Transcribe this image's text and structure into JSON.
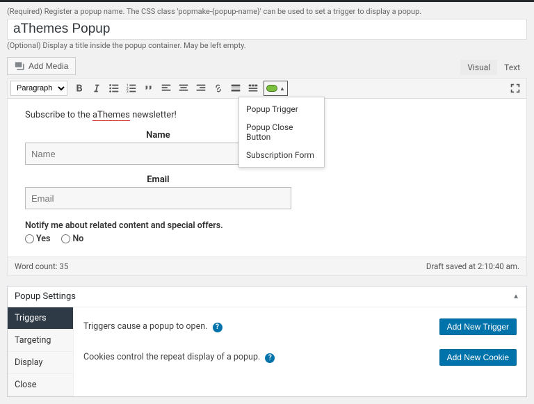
{
  "helper": {
    "name": "(Required) Register a popup name. The CSS class 'popmake-{popup-name}' can be used to set a trigger to display a popup.",
    "title": "(Optional) Display a title inside the popup container. May be left empty."
  },
  "title_value": "aThemes Popup",
  "media_button": "Add Media",
  "editor_tabs": {
    "visual": "Visual",
    "text": "Text"
  },
  "toolbar": {
    "paragraph": "Paragraph"
  },
  "dropdown": {
    "items": [
      "Popup Trigger",
      "Popup Close Button",
      "Subscription Form"
    ]
  },
  "content": {
    "subscribe_prefix": "Subscribe to the ",
    "subscribe_brand": "aThemes",
    "subscribe_suffix": " newsletter!",
    "name_label": "Name",
    "name_placeholder": "Name",
    "email_label": "Email",
    "email_placeholder": "Email",
    "notify": "Notify me about related content and special offers.",
    "yes": "Yes",
    "no": "No"
  },
  "status": {
    "wordcount": "Word count: 35",
    "draft": "Draft saved at 2:10:40 am."
  },
  "settings": {
    "panel_title": "Popup Settings",
    "tabs": [
      "Triggers",
      "Targeting",
      "Display",
      "Close"
    ],
    "triggers_desc": "Triggers cause a popup to open.",
    "add_trigger": "Add New Trigger",
    "cookies_desc": "Cookies control the repeat display of a popup.",
    "add_cookie": "Add New Cookie"
  }
}
